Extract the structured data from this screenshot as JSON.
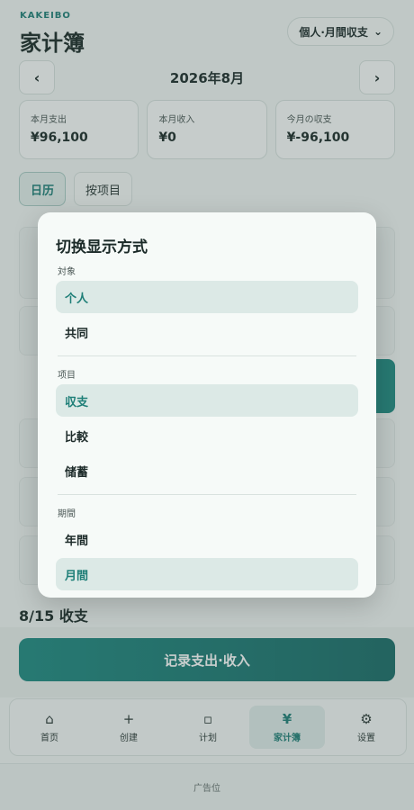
{
  "app": {
    "brand": "KAKEIBO",
    "title": "家计簿",
    "mode_button": "個人·月間収支",
    "mode_chevron": "⌄"
  },
  "month_nav": {
    "prev": "‹",
    "label": "2026年8月",
    "next": "›"
  },
  "summary": [
    {
      "label": "本月支出",
      "value": "¥96,100"
    },
    {
      "label": "本月收入",
      "value": "¥0"
    },
    {
      "label": "今月の収支",
      "value": "¥-96,100"
    }
  ],
  "view_tabs": {
    "calendar": "日历",
    "by_item": "按项目"
  },
  "day_heading": "8/15 收支",
  "record_button": "记录支出·收入",
  "bottom_nav": [
    {
      "icon": "⌂",
      "label": "首页",
      "active": false
    },
    {
      "icon": "+",
      "label": "创建",
      "active": false
    },
    {
      "icon": "▫",
      "label": "计划",
      "active": false
    },
    {
      "icon": "¥",
      "label": "家计簿",
      "active": true
    },
    {
      "icon": "⚙",
      "label": "设置",
      "active": false
    }
  ],
  "ad_label": "广告位",
  "modal": {
    "title": "切换显示方式",
    "sections": [
      {
        "label": "対象",
        "options": [
          {
            "label": "个人",
            "selected": true
          },
          {
            "label": "共同",
            "selected": false
          }
        ]
      },
      {
        "label": "项目",
        "options": [
          {
            "label": "収支",
            "selected": true
          },
          {
            "label": "比較",
            "selected": false
          },
          {
            "label": "储蓄",
            "selected": false
          }
        ]
      },
      {
        "label": "期間",
        "options": [
          {
            "label": "年間",
            "selected": false
          },
          {
            "label": "月間",
            "selected": true
          }
        ]
      }
    ]
  }
}
